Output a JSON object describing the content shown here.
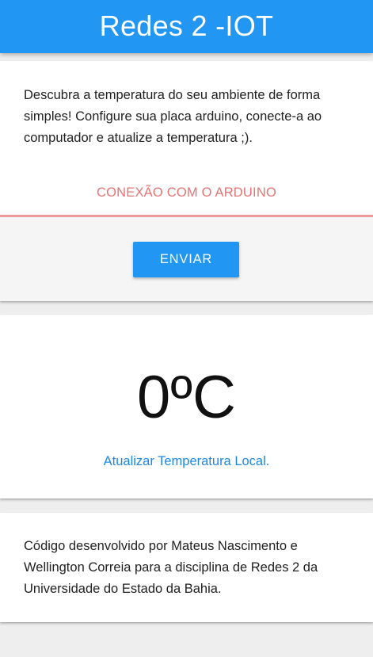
{
  "app_bar": {
    "title": "Redes 2 -IOT",
    "color": "#2196f3"
  },
  "intro_card": {
    "description": "Descubra a temperatura do seu ambiente de forma simples! Configure sua placa arduino, conecte-a ao computador e atualize a temperatura ;).",
    "connection_status": "CONEXÃO COM O ARDUINO",
    "connection_status_color": "#e57373",
    "send_button_label": "ENVIAR"
  },
  "temperature_card": {
    "value": "0ºC",
    "refresh_link_label": "Atualizar Temperatura Local."
  },
  "footer_card": {
    "credits": "Código desenvolvido por Mateus Nascimento e Wellington Correia para a disciplina de Redes 2 da Universidade do Estado da Bahia."
  }
}
